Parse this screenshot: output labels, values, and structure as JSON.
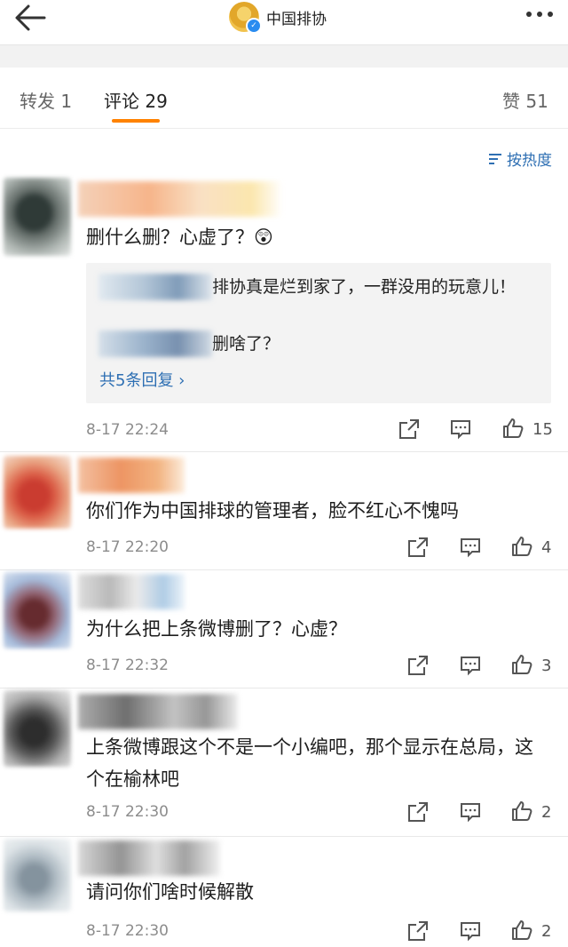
{
  "header": {
    "account_name": "中国排协",
    "back_icon": "back-arrow-icon",
    "more_icon": "more-dots-icon"
  },
  "tabs": {
    "repost_label": "转发 1",
    "comments_label": "评论 29",
    "likes_label": "赞 51",
    "active": "comments",
    "accent_color": "#ff8200"
  },
  "sort": {
    "label": "按热度",
    "icon": "sort-icon"
  },
  "link_color": "#2e6fb3",
  "comments": [
    {
      "text": "删什么删？心虚了？",
      "emoji": "😲",
      "replies": [
        "排协真是烂到家了，一群没用的玩意儿！",
        "删啥了？"
      ],
      "more_replies": "共5条回复 ›",
      "time": "8-17 22:24",
      "likes": "15"
    },
    {
      "text": "你们作为中国排球的管理者，脸不红心不愧吗",
      "time": "8-17 22:20",
      "likes": "4"
    },
    {
      "text": "为什么把上条微博删了？心虚？",
      "time": "8-17 22:32",
      "likes": "3"
    },
    {
      "text": "上条微博跟这个不是一个小编吧，那个显示在总局，这个在榆林吧",
      "time": "8-17 22:30",
      "likes": "2"
    },
    {
      "text": "请问你们啥时候解散",
      "time": "8-17 22:30",
      "likes": "2"
    }
  ]
}
